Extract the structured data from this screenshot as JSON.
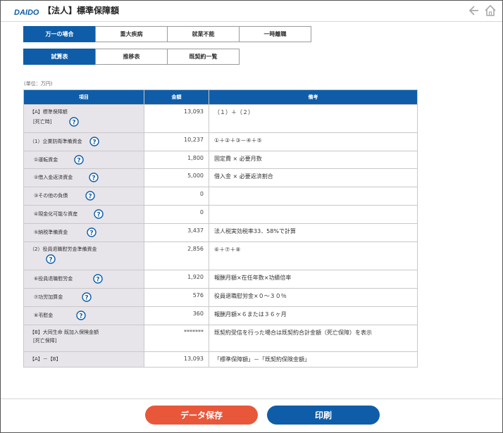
{
  "header": {
    "logo_text": "DAIDO",
    "title": "【法人】標準保障額"
  },
  "tabs_row1": [
    {
      "label": "万一の場合",
      "active": true
    },
    {
      "label": "重大疾病",
      "active": false
    },
    {
      "label": "就業不能",
      "active": false
    },
    {
      "label": "一時離職",
      "active": false
    }
  ],
  "tabs_row2": [
    {
      "label": "試算表",
      "active": true
    },
    {
      "label": "推移表",
      "active": false
    },
    {
      "label": "既契約一覧",
      "active": false
    }
  ],
  "unit_label": "(単位：万円)",
  "table": {
    "headers": {
      "item": "項目",
      "amount": "金額",
      "note": "備考"
    },
    "rows": [
      {
        "item": "【A】標準保障額",
        "item_sub": "[死亡時]",
        "amount": "13,093",
        "note": "（１）＋（２）"
      },
      {
        "item": "（1）企業防衛準備資金",
        "amount": "10,237",
        "note": "①＋②＋③－④＋⑤"
      },
      {
        "item": "①運転資金",
        "amount": "1,800",
        "note": "固定費 × 必要月数"
      },
      {
        "item": "②借入金返済資金",
        "amount": "5,000",
        "note": "借入金 × 必要返済割合"
      },
      {
        "item": "③その他の負債",
        "amount": "0",
        "note": ""
      },
      {
        "item": "④現金化可能な資産",
        "amount": "0",
        "note": ""
      },
      {
        "item": "⑤納税準備資金",
        "amount": "3,437",
        "note": "法人税実効税率33．58%で計算"
      },
      {
        "item": "（2）役員退職慰労金準備資金",
        "amount": "2,856",
        "note": "⑥＋⑦＋⑧"
      },
      {
        "item": "⑥役員退職慰労金",
        "amount": "1,920",
        "note": "報酬月額×在任年数×功績倍率"
      },
      {
        "item": "⑦功労加算金",
        "amount": "576",
        "note": "役員退職慰労金×０～３０％"
      },
      {
        "item": "⑧弔慰金",
        "amount": "360",
        "note": "報酬月額×６または３６ヶ月"
      },
      {
        "item": "【B】大同生命 既加入保険金額",
        "item_sub": "[死亡保障]",
        "amount": "*******",
        "note": "既契約受信を行った場合は既契約合計金額（死亡保障）を表示"
      },
      {
        "item": "【A】－【B】",
        "amount": "13,093",
        "note": "「標準保障額」－「既契約保険金額」"
      }
    ]
  },
  "buttons": {
    "save": "データ保存",
    "print": "印刷"
  },
  "colors": {
    "primary": "#0f5da8",
    "save": "#e8573a",
    "item_bg": "#e7e5ea"
  }
}
